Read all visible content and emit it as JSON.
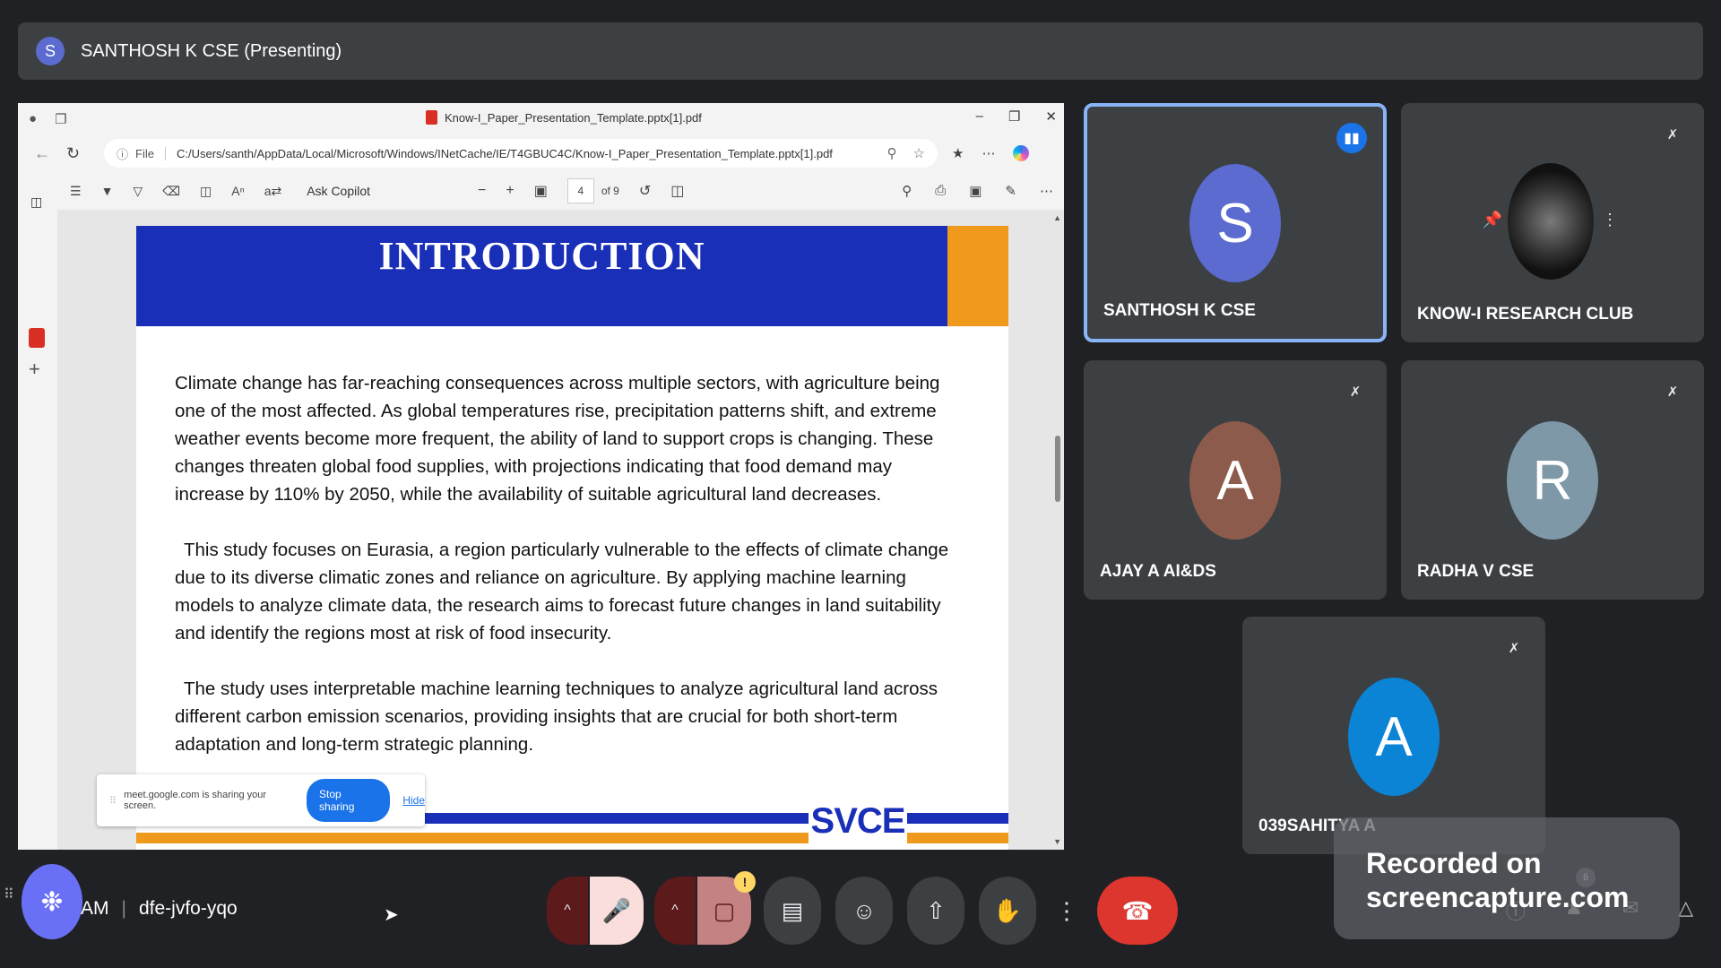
{
  "presenting_bar": {
    "avatar_letter": "S",
    "title": "SANTHOSH K CSE (Presenting)"
  },
  "browser": {
    "tab_title": "Know-I_Paper_Presentation_Template.pptx[1].pdf",
    "url_scheme": "File",
    "url_path": "C:/Users/santh/AppData/Local/Microsoft/Windows/INetCache/IE/T4GBUC4C/Know-I_Paper_Presentation_Template.pptx[1].pdf",
    "ask_copilot": "Ask Copilot",
    "page_current": "4",
    "page_total": "of 9"
  },
  "slide": {
    "title": "INTRODUCTION",
    "paragraphs": [
      "Climate change has far-reaching consequences across multiple sectors, with agriculture being one of the most affected. As global temperatures rise, precipitation patterns shift, and extreme weather events become more frequent, the ability of land to support crops is changing. These changes threaten global food supplies, with projections indicating that food demand may increase by 110% by 2050, while the availability of suitable agricultural land decreases.",
      "This study focuses on Eurasia, a region particularly vulnerable to the effects of climate change due to its diverse climatic zones and reliance on agriculture. By applying machine learning models to analyze climate data, the research aims to forecast future changes in land suitability and identify the regions most at risk of food insecurity.",
      "The study uses interpretable machine learning techniques to analyze agricultural land across different carbon emission scenarios, providing insights that are crucial for both short-term adaptation and long-term strategic planning."
    ],
    "logo_text": "SVCE"
  },
  "share_notice": {
    "text": "meet.google.com is sharing your screen.",
    "stop_label": "Stop sharing",
    "hide_label": "Hide"
  },
  "participants": [
    {
      "letter": "S",
      "name": "SANTHOSH K CSE",
      "color": "#5b6bcf",
      "speaking": true
    },
    {
      "letter": "",
      "name": "KNOW-I RESEARCH CLUB",
      "muted": true
    },
    {
      "letter": "A",
      "name": "AJAY A AI&DS",
      "color": "#8d5b4c",
      "muted": true
    },
    {
      "letter": "R",
      "name": "RADHA V CSE",
      "color": "#7f98a8",
      "muted": true
    },
    {
      "letter": "A",
      "name": "039SAHITYA A",
      "color": "#0b84d6",
      "muted": true
    }
  ],
  "meeting": {
    "time_suffix": "AM",
    "code": "dfe-jvfo-yqo"
  },
  "controls": {
    "warning_badge": "!",
    "participant_count": "6"
  },
  "watermark": {
    "line1": "Recorded on",
    "line2": "screencapture.com"
  }
}
